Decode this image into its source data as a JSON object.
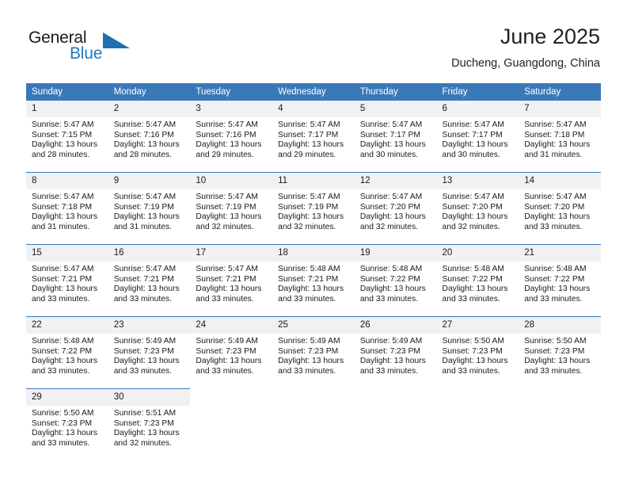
{
  "brand": {
    "name_part1": "General",
    "name_part2": "Blue",
    "triangle_icon": "brand-triangle-icon",
    "accent_color": "#1F78C1"
  },
  "header": {
    "title": "June 2025",
    "location": "Ducheng, Guangdong, China"
  },
  "theme": {
    "header_blue": "#3A79B8",
    "daynum_background": "#F1F1F1",
    "text": "#1a1a1a"
  },
  "calendar": {
    "weekday_headers": [
      "Sunday",
      "Monday",
      "Tuesday",
      "Wednesday",
      "Thursday",
      "Friday",
      "Saturday"
    ],
    "weeks": [
      [
        {
          "day": "1",
          "sunrise": "Sunrise: 5:47 AM",
          "sunset": "Sunset: 7:15 PM",
          "daylight_line1": "Daylight: 13 hours",
          "daylight_line2": "and 28 minutes."
        },
        {
          "day": "2",
          "sunrise": "Sunrise: 5:47 AM",
          "sunset": "Sunset: 7:16 PM",
          "daylight_line1": "Daylight: 13 hours",
          "daylight_line2": "and 28 minutes."
        },
        {
          "day": "3",
          "sunrise": "Sunrise: 5:47 AM",
          "sunset": "Sunset: 7:16 PM",
          "daylight_line1": "Daylight: 13 hours",
          "daylight_line2": "and 29 minutes."
        },
        {
          "day": "4",
          "sunrise": "Sunrise: 5:47 AM",
          "sunset": "Sunset: 7:17 PM",
          "daylight_line1": "Daylight: 13 hours",
          "daylight_line2": "and 29 minutes."
        },
        {
          "day": "5",
          "sunrise": "Sunrise: 5:47 AM",
          "sunset": "Sunset: 7:17 PM",
          "daylight_line1": "Daylight: 13 hours",
          "daylight_line2": "and 30 minutes."
        },
        {
          "day": "6",
          "sunrise": "Sunrise: 5:47 AM",
          "sunset": "Sunset: 7:17 PM",
          "daylight_line1": "Daylight: 13 hours",
          "daylight_line2": "and 30 minutes."
        },
        {
          "day": "7",
          "sunrise": "Sunrise: 5:47 AM",
          "sunset": "Sunset: 7:18 PM",
          "daylight_line1": "Daylight: 13 hours",
          "daylight_line2": "and 31 minutes."
        }
      ],
      [
        {
          "day": "8",
          "sunrise": "Sunrise: 5:47 AM",
          "sunset": "Sunset: 7:18 PM",
          "daylight_line1": "Daylight: 13 hours",
          "daylight_line2": "and 31 minutes."
        },
        {
          "day": "9",
          "sunrise": "Sunrise: 5:47 AM",
          "sunset": "Sunset: 7:19 PM",
          "daylight_line1": "Daylight: 13 hours",
          "daylight_line2": "and 31 minutes."
        },
        {
          "day": "10",
          "sunrise": "Sunrise: 5:47 AM",
          "sunset": "Sunset: 7:19 PM",
          "daylight_line1": "Daylight: 13 hours",
          "daylight_line2": "and 32 minutes."
        },
        {
          "day": "11",
          "sunrise": "Sunrise: 5:47 AM",
          "sunset": "Sunset: 7:19 PM",
          "daylight_line1": "Daylight: 13 hours",
          "daylight_line2": "and 32 minutes."
        },
        {
          "day": "12",
          "sunrise": "Sunrise: 5:47 AM",
          "sunset": "Sunset: 7:20 PM",
          "daylight_line1": "Daylight: 13 hours",
          "daylight_line2": "and 32 minutes."
        },
        {
          "day": "13",
          "sunrise": "Sunrise: 5:47 AM",
          "sunset": "Sunset: 7:20 PM",
          "daylight_line1": "Daylight: 13 hours",
          "daylight_line2": "and 32 minutes."
        },
        {
          "day": "14",
          "sunrise": "Sunrise: 5:47 AM",
          "sunset": "Sunset: 7:20 PM",
          "daylight_line1": "Daylight: 13 hours",
          "daylight_line2": "and 33 minutes."
        }
      ],
      [
        {
          "day": "15",
          "sunrise": "Sunrise: 5:47 AM",
          "sunset": "Sunset: 7:21 PM",
          "daylight_line1": "Daylight: 13 hours",
          "daylight_line2": "and 33 minutes."
        },
        {
          "day": "16",
          "sunrise": "Sunrise: 5:47 AM",
          "sunset": "Sunset: 7:21 PM",
          "daylight_line1": "Daylight: 13 hours",
          "daylight_line2": "and 33 minutes."
        },
        {
          "day": "17",
          "sunrise": "Sunrise: 5:47 AM",
          "sunset": "Sunset: 7:21 PM",
          "daylight_line1": "Daylight: 13 hours",
          "daylight_line2": "and 33 minutes."
        },
        {
          "day": "18",
          "sunrise": "Sunrise: 5:48 AM",
          "sunset": "Sunset: 7:21 PM",
          "daylight_line1": "Daylight: 13 hours",
          "daylight_line2": "and 33 minutes."
        },
        {
          "day": "19",
          "sunrise": "Sunrise: 5:48 AM",
          "sunset": "Sunset: 7:22 PM",
          "daylight_line1": "Daylight: 13 hours",
          "daylight_line2": "and 33 minutes."
        },
        {
          "day": "20",
          "sunrise": "Sunrise: 5:48 AM",
          "sunset": "Sunset: 7:22 PM",
          "daylight_line1": "Daylight: 13 hours",
          "daylight_line2": "and 33 minutes."
        },
        {
          "day": "21",
          "sunrise": "Sunrise: 5:48 AM",
          "sunset": "Sunset: 7:22 PM",
          "daylight_line1": "Daylight: 13 hours",
          "daylight_line2": "and 33 minutes."
        }
      ],
      [
        {
          "day": "22",
          "sunrise": "Sunrise: 5:48 AM",
          "sunset": "Sunset: 7:22 PM",
          "daylight_line1": "Daylight: 13 hours",
          "daylight_line2": "and 33 minutes."
        },
        {
          "day": "23",
          "sunrise": "Sunrise: 5:49 AM",
          "sunset": "Sunset: 7:23 PM",
          "daylight_line1": "Daylight: 13 hours",
          "daylight_line2": "and 33 minutes."
        },
        {
          "day": "24",
          "sunrise": "Sunrise: 5:49 AM",
          "sunset": "Sunset: 7:23 PM",
          "daylight_line1": "Daylight: 13 hours",
          "daylight_line2": "and 33 minutes."
        },
        {
          "day": "25",
          "sunrise": "Sunrise: 5:49 AM",
          "sunset": "Sunset: 7:23 PM",
          "daylight_line1": "Daylight: 13 hours",
          "daylight_line2": "and 33 minutes."
        },
        {
          "day": "26",
          "sunrise": "Sunrise: 5:49 AM",
          "sunset": "Sunset: 7:23 PM",
          "daylight_line1": "Daylight: 13 hours",
          "daylight_line2": "and 33 minutes."
        },
        {
          "day": "27",
          "sunrise": "Sunrise: 5:50 AM",
          "sunset": "Sunset: 7:23 PM",
          "daylight_line1": "Daylight: 13 hours",
          "daylight_line2": "and 33 minutes."
        },
        {
          "day": "28",
          "sunrise": "Sunrise: 5:50 AM",
          "sunset": "Sunset: 7:23 PM",
          "daylight_line1": "Daylight: 13 hours",
          "daylight_line2": "and 33 minutes."
        }
      ],
      [
        {
          "day": "29",
          "sunrise": "Sunrise: 5:50 AM",
          "sunset": "Sunset: 7:23 PM",
          "daylight_line1": "Daylight: 13 hours",
          "daylight_line2": "and 33 minutes."
        },
        {
          "day": "30",
          "sunrise": "Sunrise: 5:51 AM",
          "sunset": "Sunset: 7:23 PM",
          "daylight_line1": "Daylight: 13 hours",
          "daylight_line2": "and 32 minutes."
        },
        null,
        null,
        null,
        null,
        null
      ]
    ]
  }
}
